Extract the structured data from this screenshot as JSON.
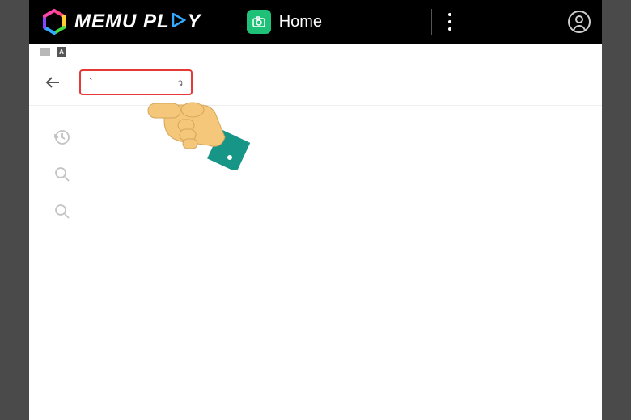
{
  "header": {
    "brand_name": "MEMU PLAY",
    "home_label": "Home"
  },
  "search": {
    "input_value": "",
    "placeholder": ""
  },
  "suggestions": [
    {
      "type": "history",
      "label": ""
    },
    {
      "type": "search",
      "label": ""
    },
    {
      "type": "search",
      "label": ""
    }
  ],
  "colors": {
    "accent_red": "#e53935",
    "home_green": "#1fc178",
    "header_bg": "#000000"
  }
}
